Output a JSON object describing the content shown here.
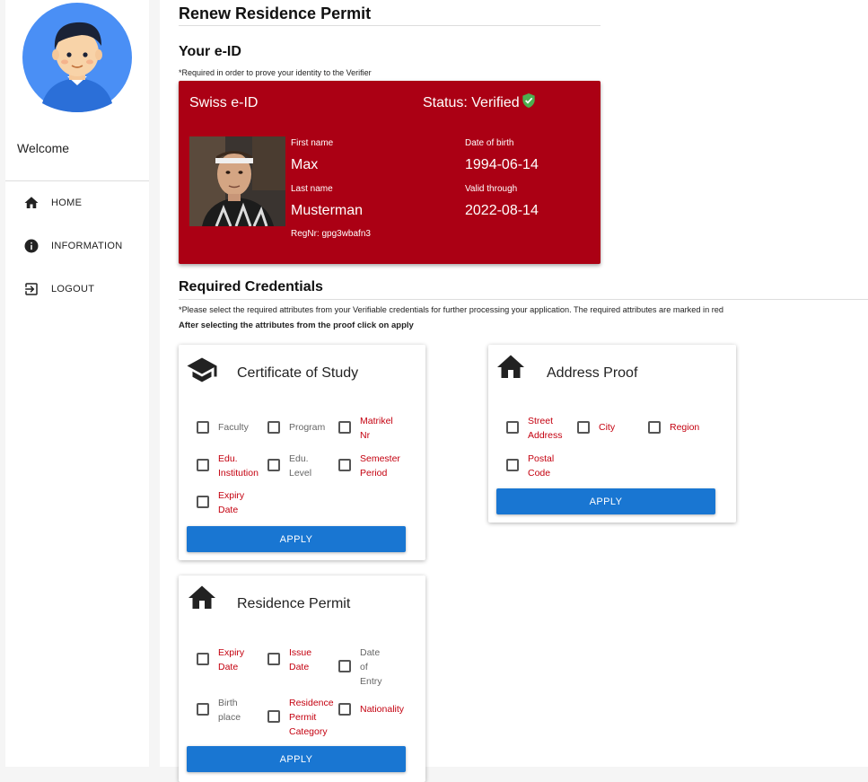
{
  "sidebar": {
    "welcome": "Welcome",
    "nav": [
      {
        "label": "HOME",
        "icon": "home-icon"
      },
      {
        "label": "INFORMATION",
        "icon": "info-icon"
      },
      {
        "label": "LOGOUT",
        "icon": "logout-icon"
      }
    ]
  },
  "page": {
    "title": "Renew Residence Permit"
  },
  "eid_section": {
    "heading": "Your e-ID",
    "note": "*Required in order to prove your identity to the Verifier"
  },
  "eid_card": {
    "title": "Swiss e-ID",
    "status": "Status: Verified",
    "status_icon": "verified-shield-icon",
    "color": "#ab0014",
    "first_name_label": "First name",
    "first_name": "Max",
    "last_name_label": "Last name",
    "last_name": "Musterman",
    "dob_label": "Date of birth",
    "dob": "1994-06-14",
    "valid_label": "Valid through",
    "valid": "2022-08-14",
    "regnr": "RegNr: gpg3wbafn3"
  },
  "credentials_section": {
    "heading": "Required Credentials",
    "note": "*Please select the required attributes from your Verifiable credentials for further processing your application. The required attributes are marked in red",
    "note2": "After selecting the attributes from the proof click on apply"
  },
  "colors": {
    "required": "#c4000f",
    "optional": "#666666",
    "primary": "#1976d2"
  },
  "cards": {
    "study": {
      "title": "Certificate of Study",
      "icon": "graduation-cap-icon",
      "attrs": [
        {
          "l1": "Faculty",
          "l2": "",
          "l3": "",
          "req": false
        },
        {
          "l1": "Program",
          "l2": "",
          "l3": "",
          "req": false
        },
        {
          "l1": "Matrikel",
          "l2": "Nr",
          "l3": "",
          "req": true
        },
        {
          "l1": "Edu.",
          "l2": "Institution",
          "l3": "",
          "req": true
        },
        {
          "l1": "Edu.",
          "l2": "Level",
          "l3": "",
          "req": false
        },
        {
          "l1": "Semester",
          "l2": "Period",
          "l3": "",
          "req": true
        },
        {
          "l1": "Expiry",
          "l2": "Date",
          "l3": "",
          "req": true
        }
      ],
      "apply": "APPLY"
    },
    "address": {
      "title": "Address Proof",
      "icon": "house-icon",
      "attrs": [
        {
          "l1": "Street",
          "l2": "Address",
          "l3": "",
          "req": true
        },
        {
          "l1": "City",
          "l2": "",
          "l3": "",
          "req": true
        },
        {
          "l1": "Region",
          "l2": "",
          "l3": "",
          "req": true
        },
        {
          "l1": "Postal",
          "l2": "Code",
          "l3": "",
          "req": true
        }
      ],
      "apply": "APPLY"
    },
    "residence": {
      "title": "Residence Permit",
      "icon": "house-icon",
      "attrs": [
        {
          "l1": "Expiry",
          "l2": "Date",
          "l3": "",
          "req": true
        },
        {
          "l1": "Issue",
          "l2": "Date",
          "l3": "",
          "req": true
        },
        {
          "l1": "Date",
          "l2": "of",
          "l3": "Entry",
          "req": false
        },
        {
          "l1": "Birth",
          "l2": "place",
          "l3": "",
          "req": false
        },
        {
          "l1": "Residence",
          "l2": "Permit",
          "l3": "Category",
          "req": true
        },
        {
          "l1": "Nationality",
          "l2": "",
          "l3": "",
          "req": true
        }
      ],
      "apply": "APPLY"
    }
  }
}
